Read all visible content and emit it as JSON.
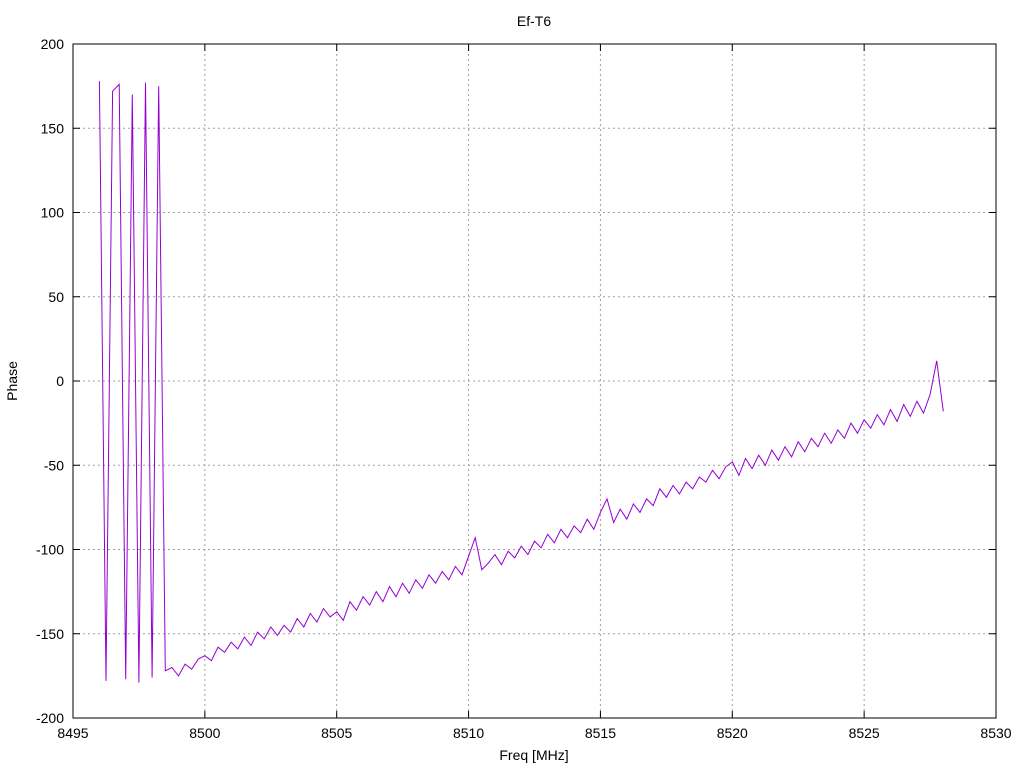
{
  "chart_data": {
    "type": "line",
    "title": "Ef-T6",
    "xlabel": "Freq [MHz]",
    "ylabel": "Phase",
    "xlim": [
      8495,
      8530
    ],
    "ylim": [
      -200,
      200
    ],
    "xticks": [
      8495,
      8500,
      8505,
      8510,
      8515,
      8520,
      8525,
      8530
    ],
    "yticks": [
      -200,
      -150,
      -100,
      -50,
      0,
      50,
      100,
      150,
      200
    ],
    "grid": true,
    "legend": "none",
    "series": [
      {
        "name": "Phase",
        "color": "#9400d3",
        "x_start": 8496,
        "x_step": 0.25,
        "values": [
          178,
          -178,
          172,
          176,
          -177,
          170,
          -179,
          177,
          -176,
          175,
          -172,
          -170,
          -175,
          -168,
          -171,
          -165,
          -163,
          -166,
          -158,
          -161,
          -155,
          -159,
          -152,
          -157,
          -149,
          -153,
          -146,
          -151,
          -145,
          -149,
          -141,
          -146,
          -138,
          -143,
          -135,
          -140,
          -137,
          -142,
          -131,
          -136,
          -128,
          -133,
          -125,
          -131,
          -122,
          -128,
          -120,
          -126,
          -118,
          -123,
          -115,
          -120,
          -113,
          -118,
          -110,
          -115,
          -104,
          -93,
          -112,
          -108,
          -103,
          -109,
          -101,
          -105,
          -98,
          -103,
          -95,
          -99,
          -91,
          -96,
          -88,
          -93,
          -86,
          -90,
          -82,
          -88,
          -78,
          -70,
          -84,
          -76,
          -82,
          -73,
          -78,
          -70,
          -74,
          -64,
          -69,
          -62,
          -67,
          -60,
          -64,
          -57,
          -60,
          -53,
          -58,
          -51,
          -48,
          -56,
          -46,
          -52,
          -44,
          -50,
          -41,
          -47,
          -39,
          -45,
          -36,
          -42,
          -34,
          -39,
          -31,
          -37,
          -29,
          -34,
          -25,
          -31,
          -23,
          -28,
          -20,
          -26,
          -17,
          -24,
          -14,
          -21,
          -12,
          -19,
          -8,
          12,
          -18
        ]
      }
    ]
  }
}
